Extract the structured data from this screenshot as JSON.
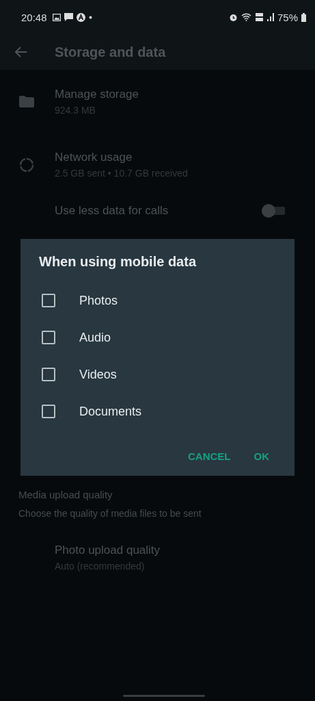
{
  "status_bar": {
    "time": "20:48",
    "battery": "75%"
  },
  "app_bar": {
    "title": "Storage and data"
  },
  "settings": [
    {
      "kind": "storage",
      "title": "Manage storage",
      "subtitle": "924.3 MB"
    },
    {
      "kind": "network",
      "title": "Network usage",
      "subtitle": "2.5 GB sent • 10.7 GB received"
    },
    {
      "kind": "toggle",
      "title": "Use less data for calls",
      "on": false
    }
  ],
  "media_upload": {
    "header": "Media upload quality",
    "description": "Choose the quality of media files to be sent",
    "items": [
      {
        "title": "Photo upload quality",
        "subtitle": "Auto (recommended)"
      }
    ]
  },
  "dialog": {
    "title": "When using mobile data",
    "options": [
      {
        "label": "Photos",
        "checked": false
      },
      {
        "label": "Audio",
        "checked": false
      },
      {
        "label": "Videos",
        "checked": false
      },
      {
        "label": "Documents",
        "checked": false
      }
    ],
    "buttons": [
      "CANCEL",
      "OK"
    ]
  }
}
